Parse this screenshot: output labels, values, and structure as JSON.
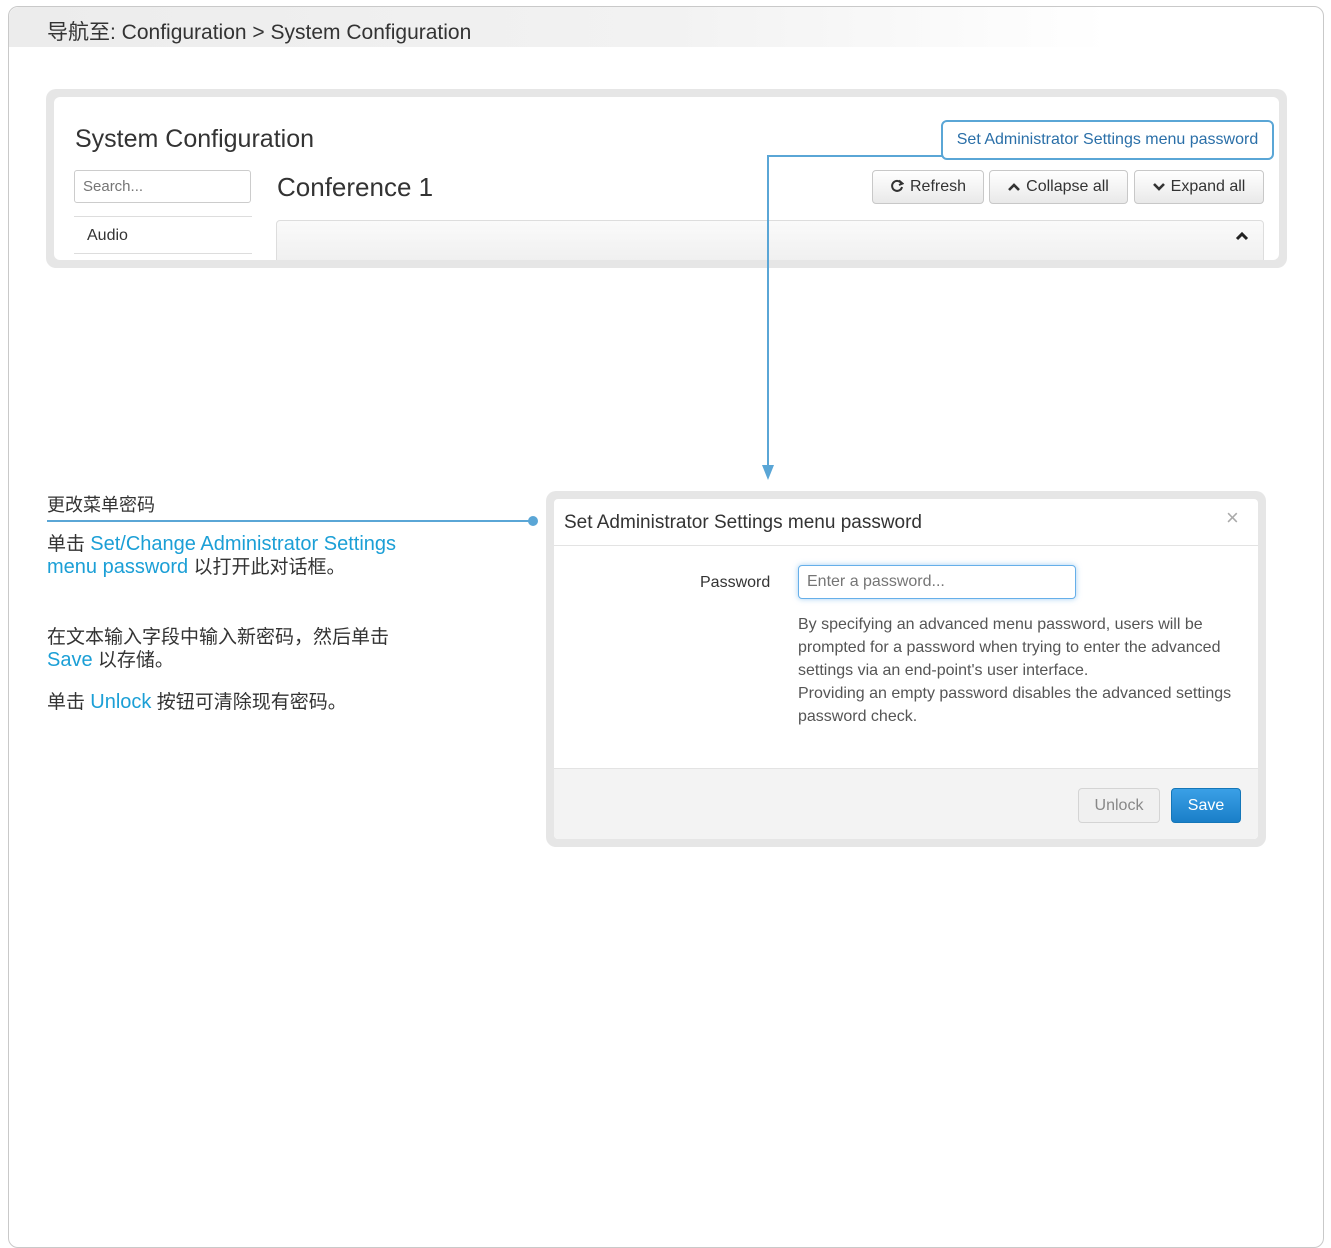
{
  "nav": {
    "breadcrumb": "导航至: Configuration > System Configuration"
  },
  "top": {
    "title": "System Configuration",
    "search_placeholder": "Search...",
    "sidebar_item": "Audio",
    "section_title": "Conference 1",
    "refresh_label": "Refresh",
    "collapse_label": "Collapse all",
    "expand_label": "Expand all",
    "admin_link": "Set Administrator Settings menu password"
  },
  "instructions": {
    "heading": "更改菜单密码",
    "p1_pre": "单击 ",
    "p1_hl": "Set/Change Administrator Settings menu password",
    "p1_post": " 以打开此对话框。",
    "p2_pre": "在文本输入字段中输入新密码，然后单击 ",
    "p2_hl": "Save",
    "p2_post": " 以存储。",
    "p3_pre": "单击 ",
    "p3_hl": "Unlock",
    "p3_post": " 按钮可清除现有密码。"
  },
  "dialog": {
    "title": "Set Administrator Settings menu password",
    "close_glyph": "×",
    "password_label": "Password",
    "password_placeholder": "Enter a password...",
    "help_1": "By specifying an advanced menu password, users will be prompted for a password when trying to enter the advanced settings via an end-point's user interface.",
    "help_2": "Providing an empty password disables the advanced settings password check.",
    "unlock_label": "Unlock",
    "save_label": "Save"
  },
  "icons": {
    "refresh": "refresh-icon",
    "collapse": "chevron-up-icon",
    "expand": "chevron-down-icon",
    "section": "chevron-up-icon",
    "close": "close-icon"
  },
  "colors": {
    "accent": "#5aa6d6",
    "highlight_text": "#1b9fd6",
    "save_button": "#1a7fc8",
    "link_text": "#2a6fa8"
  }
}
